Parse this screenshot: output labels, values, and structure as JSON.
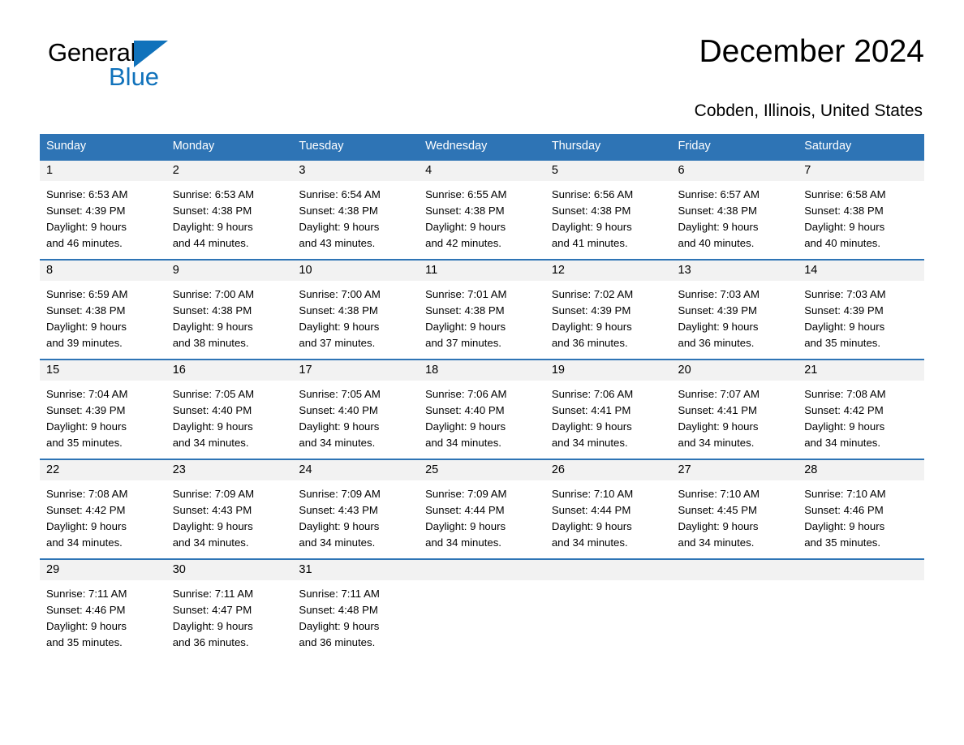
{
  "brand": {
    "name_part1": "General",
    "name_part2": "Blue",
    "triangle_color": "#1072bb",
    "accent_color": "#2e74b5"
  },
  "header": {
    "title": "December 2024",
    "location": "Cobden, Illinois, United States"
  },
  "calendar": {
    "weekdays": [
      "Sunday",
      "Monday",
      "Tuesday",
      "Wednesday",
      "Thursday",
      "Friday",
      "Saturday"
    ],
    "weeks": [
      [
        {
          "day": "1",
          "sunrise": "Sunrise: 6:53 AM",
          "sunset": "Sunset: 4:39 PM",
          "daylight_line1": "Daylight: 9 hours",
          "daylight_line2": "and 46 minutes."
        },
        {
          "day": "2",
          "sunrise": "Sunrise: 6:53 AM",
          "sunset": "Sunset: 4:38 PM",
          "daylight_line1": "Daylight: 9 hours",
          "daylight_line2": "and 44 minutes."
        },
        {
          "day": "3",
          "sunrise": "Sunrise: 6:54 AM",
          "sunset": "Sunset: 4:38 PM",
          "daylight_line1": "Daylight: 9 hours",
          "daylight_line2": "and 43 minutes."
        },
        {
          "day": "4",
          "sunrise": "Sunrise: 6:55 AM",
          "sunset": "Sunset: 4:38 PM",
          "daylight_line1": "Daylight: 9 hours",
          "daylight_line2": "and 42 minutes."
        },
        {
          "day": "5",
          "sunrise": "Sunrise: 6:56 AM",
          "sunset": "Sunset: 4:38 PM",
          "daylight_line1": "Daylight: 9 hours",
          "daylight_line2": "and 41 minutes."
        },
        {
          "day": "6",
          "sunrise": "Sunrise: 6:57 AM",
          "sunset": "Sunset: 4:38 PM",
          "daylight_line1": "Daylight: 9 hours",
          "daylight_line2": "and 40 minutes."
        },
        {
          "day": "7",
          "sunrise": "Sunrise: 6:58 AM",
          "sunset": "Sunset: 4:38 PM",
          "daylight_line1": "Daylight: 9 hours",
          "daylight_line2": "and 40 minutes."
        }
      ],
      [
        {
          "day": "8",
          "sunrise": "Sunrise: 6:59 AM",
          "sunset": "Sunset: 4:38 PM",
          "daylight_line1": "Daylight: 9 hours",
          "daylight_line2": "and 39 minutes."
        },
        {
          "day": "9",
          "sunrise": "Sunrise: 7:00 AM",
          "sunset": "Sunset: 4:38 PM",
          "daylight_line1": "Daylight: 9 hours",
          "daylight_line2": "and 38 minutes."
        },
        {
          "day": "10",
          "sunrise": "Sunrise: 7:00 AM",
          "sunset": "Sunset: 4:38 PM",
          "daylight_line1": "Daylight: 9 hours",
          "daylight_line2": "and 37 minutes."
        },
        {
          "day": "11",
          "sunrise": "Sunrise: 7:01 AM",
          "sunset": "Sunset: 4:38 PM",
          "daylight_line1": "Daylight: 9 hours",
          "daylight_line2": "and 37 minutes."
        },
        {
          "day": "12",
          "sunrise": "Sunrise: 7:02 AM",
          "sunset": "Sunset: 4:39 PM",
          "daylight_line1": "Daylight: 9 hours",
          "daylight_line2": "and 36 minutes."
        },
        {
          "day": "13",
          "sunrise": "Sunrise: 7:03 AM",
          "sunset": "Sunset: 4:39 PM",
          "daylight_line1": "Daylight: 9 hours",
          "daylight_line2": "and 36 minutes."
        },
        {
          "day": "14",
          "sunrise": "Sunrise: 7:03 AM",
          "sunset": "Sunset: 4:39 PM",
          "daylight_line1": "Daylight: 9 hours",
          "daylight_line2": "and 35 minutes."
        }
      ],
      [
        {
          "day": "15",
          "sunrise": "Sunrise: 7:04 AM",
          "sunset": "Sunset: 4:39 PM",
          "daylight_line1": "Daylight: 9 hours",
          "daylight_line2": "and 35 minutes."
        },
        {
          "day": "16",
          "sunrise": "Sunrise: 7:05 AM",
          "sunset": "Sunset: 4:40 PM",
          "daylight_line1": "Daylight: 9 hours",
          "daylight_line2": "and 34 minutes."
        },
        {
          "day": "17",
          "sunrise": "Sunrise: 7:05 AM",
          "sunset": "Sunset: 4:40 PM",
          "daylight_line1": "Daylight: 9 hours",
          "daylight_line2": "and 34 minutes."
        },
        {
          "day": "18",
          "sunrise": "Sunrise: 7:06 AM",
          "sunset": "Sunset: 4:40 PM",
          "daylight_line1": "Daylight: 9 hours",
          "daylight_line2": "and 34 minutes."
        },
        {
          "day": "19",
          "sunrise": "Sunrise: 7:06 AM",
          "sunset": "Sunset: 4:41 PM",
          "daylight_line1": "Daylight: 9 hours",
          "daylight_line2": "and 34 minutes."
        },
        {
          "day": "20",
          "sunrise": "Sunrise: 7:07 AM",
          "sunset": "Sunset: 4:41 PM",
          "daylight_line1": "Daylight: 9 hours",
          "daylight_line2": "and 34 minutes."
        },
        {
          "day": "21",
          "sunrise": "Sunrise: 7:08 AM",
          "sunset": "Sunset: 4:42 PM",
          "daylight_line1": "Daylight: 9 hours",
          "daylight_line2": "and 34 minutes."
        }
      ],
      [
        {
          "day": "22",
          "sunrise": "Sunrise: 7:08 AM",
          "sunset": "Sunset: 4:42 PM",
          "daylight_line1": "Daylight: 9 hours",
          "daylight_line2": "and 34 minutes."
        },
        {
          "day": "23",
          "sunrise": "Sunrise: 7:09 AM",
          "sunset": "Sunset: 4:43 PM",
          "daylight_line1": "Daylight: 9 hours",
          "daylight_line2": "and 34 minutes."
        },
        {
          "day": "24",
          "sunrise": "Sunrise: 7:09 AM",
          "sunset": "Sunset: 4:43 PM",
          "daylight_line1": "Daylight: 9 hours",
          "daylight_line2": "and 34 minutes."
        },
        {
          "day": "25",
          "sunrise": "Sunrise: 7:09 AM",
          "sunset": "Sunset: 4:44 PM",
          "daylight_line1": "Daylight: 9 hours",
          "daylight_line2": "and 34 minutes."
        },
        {
          "day": "26",
          "sunrise": "Sunrise: 7:10 AM",
          "sunset": "Sunset: 4:44 PM",
          "daylight_line1": "Daylight: 9 hours",
          "daylight_line2": "and 34 minutes."
        },
        {
          "day": "27",
          "sunrise": "Sunrise: 7:10 AM",
          "sunset": "Sunset: 4:45 PM",
          "daylight_line1": "Daylight: 9 hours",
          "daylight_line2": "and 34 minutes."
        },
        {
          "day": "28",
          "sunrise": "Sunrise: 7:10 AM",
          "sunset": "Sunset: 4:46 PM",
          "daylight_line1": "Daylight: 9 hours",
          "daylight_line2": "and 35 minutes."
        }
      ],
      [
        {
          "day": "29",
          "sunrise": "Sunrise: 7:11 AM",
          "sunset": "Sunset: 4:46 PM",
          "daylight_line1": "Daylight: 9 hours",
          "daylight_line2": "and 35 minutes."
        },
        {
          "day": "30",
          "sunrise": "Sunrise: 7:11 AM",
          "sunset": "Sunset: 4:47 PM",
          "daylight_line1": "Daylight: 9 hours",
          "daylight_line2": "and 36 minutes."
        },
        {
          "day": "31",
          "sunrise": "Sunrise: 7:11 AM",
          "sunset": "Sunset: 4:48 PM",
          "daylight_line1": "Daylight: 9 hours",
          "daylight_line2": "and 36 minutes."
        },
        {
          "day": "",
          "sunrise": "",
          "sunset": "",
          "daylight_line1": "",
          "daylight_line2": ""
        },
        {
          "day": "",
          "sunrise": "",
          "sunset": "",
          "daylight_line1": "",
          "daylight_line2": ""
        },
        {
          "day": "",
          "sunrise": "",
          "sunset": "",
          "daylight_line1": "",
          "daylight_line2": ""
        },
        {
          "day": "",
          "sunrise": "",
          "sunset": "",
          "daylight_line1": "",
          "daylight_line2": ""
        }
      ]
    ]
  }
}
